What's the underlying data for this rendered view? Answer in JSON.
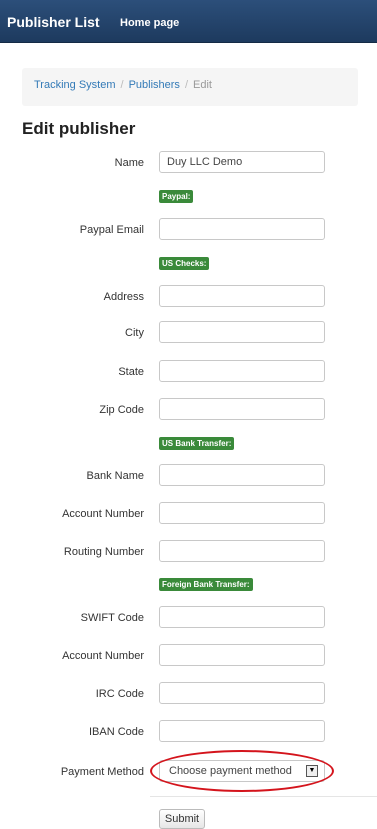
{
  "navbar": {
    "brand": "Publisher List",
    "home": "Home page"
  },
  "breadcrumb": [
    "Tracking System",
    "Publishers",
    "Edit"
  ],
  "page_title": "Edit publisher",
  "form": {
    "name": {
      "label": "Name",
      "value": "Duy LLC Demo"
    },
    "sections": {
      "paypal": "Paypal:",
      "us_checks": "US Checks:",
      "us_bank": "US Bank Transfer:",
      "foreign_bank": "Foreign Bank Transfer:"
    },
    "paypal_email": {
      "label": "Paypal Email",
      "value": ""
    },
    "address": {
      "label": "Address",
      "value": ""
    },
    "city": {
      "label": "City",
      "value": ""
    },
    "state": {
      "label": "State",
      "value": ""
    },
    "zip": {
      "label": "Zip Code",
      "value": ""
    },
    "bank_name": {
      "label": "Bank Name",
      "value": ""
    },
    "account_number_us": {
      "label": "Account Number",
      "value": ""
    },
    "routing_number": {
      "label": "Routing Number",
      "value": ""
    },
    "swift_code": {
      "label": "SWIFT Code",
      "value": ""
    },
    "account_number_foreign": {
      "label": "Account Number",
      "value": ""
    },
    "irc_code": {
      "label": "IRC Code",
      "value": ""
    },
    "iban_code": {
      "label": "IBAN Code",
      "value": ""
    },
    "payment_method": {
      "label": "Payment Method",
      "selected": "Choose payment method"
    },
    "submit": "Submit"
  },
  "icons": {
    "select_arrow": "chevron-down-icon"
  },
  "colors": {
    "navbar": "#1d3a5e",
    "badge": "#3a8a3a",
    "annotation": "#d4141c",
    "link": "#337ab7"
  }
}
